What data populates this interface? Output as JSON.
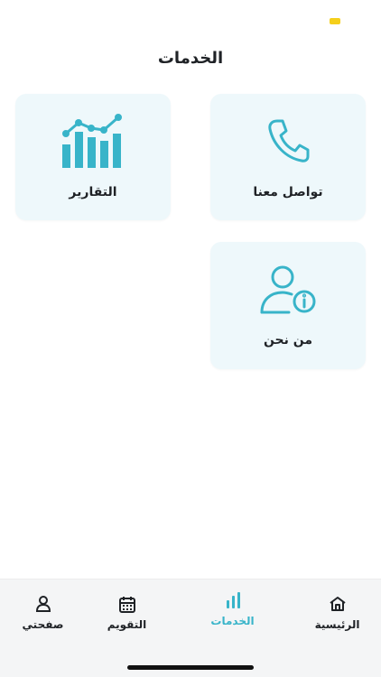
{
  "header": {
    "title": "الخدمات"
  },
  "services": {
    "contact": {
      "label": "تواصل معنا",
      "icon": "phone-icon"
    },
    "reports": {
      "label": "التقارير",
      "icon": "bar-chart-icon"
    },
    "about": {
      "label": "من نحن",
      "icon": "user-info-icon"
    }
  },
  "bottom_nav": {
    "home": {
      "label": "الرئيسية",
      "icon": "home-icon"
    },
    "services": {
      "label": "الخدمات",
      "icon": "bar-chart-icon",
      "active": true
    },
    "calendar": {
      "label": "التقويم",
      "icon": "calendar-icon"
    },
    "profile": {
      "label": "صفحتي",
      "icon": "user-icon"
    }
  },
  "colors": {
    "accent": "#38b4c9",
    "card_bg": "#eef8fb",
    "text": "#1f2226",
    "nav_bg": "#f4f5f6",
    "status_dot": "#f5cf1b"
  }
}
